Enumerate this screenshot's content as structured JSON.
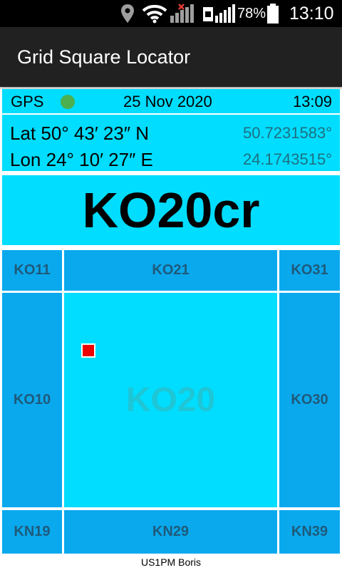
{
  "status_bar": {
    "battery_percent": "78%",
    "time": "13:10",
    "icons": [
      "location-icon",
      "wifi-icon",
      "mobile-signal-no-data-icon",
      "mobile-signal-icon",
      "battery-icon"
    ]
  },
  "app": {
    "title": "Grid Square Locator"
  },
  "gps": {
    "label": "GPS",
    "status_color": "#4caf50",
    "date": "25 Nov 2020",
    "time": "13:09"
  },
  "coords": {
    "lat_dms": "Lat  50° 43′ 23″ N",
    "lat_decimal": "50.7231583°",
    "lon_dms": "Lon 24° 10′ 27″ E",
    "lon_decimal": "24.1743515°"
  },
  "locator": "KO20cr",
  "grid": {
    "nw": "KO11",
    "n": "KO21",
    "ne": "KO31",
    "w": "KO10",
    "center": "KO20",
    "e": "KO30",
    "sw": "KN19",
    "s": "KN29",
    "se": "KN39"
  },
  "marker_color": "#ee0000",
  "footer": "US1PM Boris"
}
